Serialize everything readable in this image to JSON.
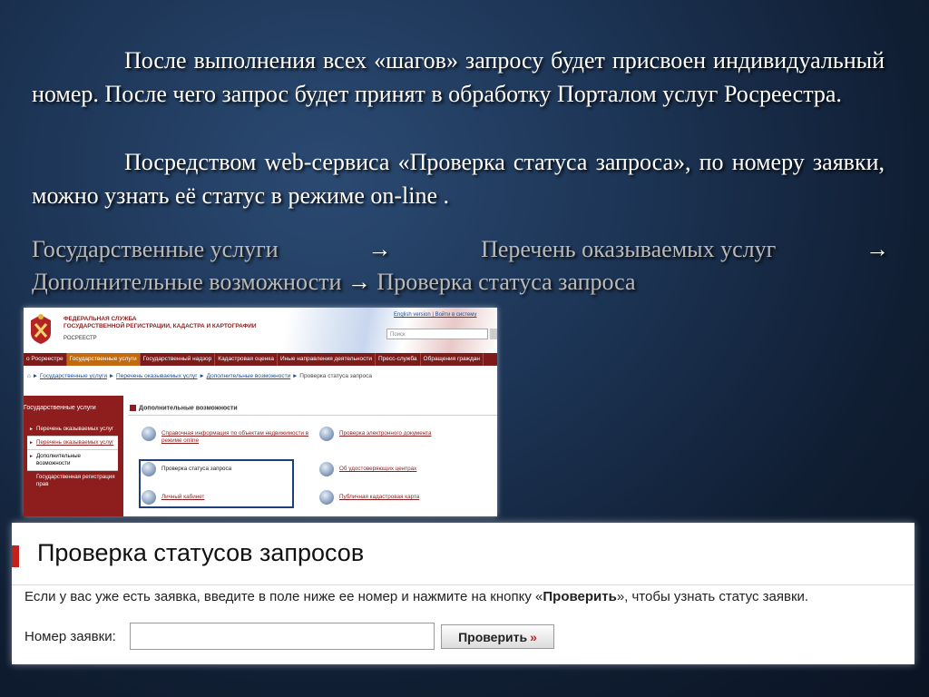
{
  "slide": {
    "p1": "После выполнения всех «шагов» запросу будет  присвоен индивидуальный номер.  После чего запрос будет принят в обработку Порталом услуг Росреестра.",
    "p2": "Посредством web-сервиса «Проверка статуса запроса», по номеру заявки, можно узнать её статус в режиме on-line .",
    "nav_path": {
      "item1": "Государственные услуги",
      "item2": "Перечень оказываемых услуг",
      "item3": "Дополнительные возможности",
      "item4": "Проверка статуса запроса",
      "arrow": "→"
    }
  },
  "portal": {
    "org_line1": "ФЕДЕРАЛЬНАЯ СЛУЖБА",
    "org_line2": "ГОСУДАРСТВЕННОЙ РЕГИСТРАЦИИ, КАДАСТРА И КАРТОГРАФИИ",
    "org_short": "РОСРЕЕСТР",
    "toplinks": "English version | Войти в систему",
    "search_placeholder": "Поиск",
    "menu": [
      "о Росреестре",
      "Государственные услуги",
      "Государственный надзор",
      "Кадастровая оценка",
      "Иные направления деятельности",
      "Пресс-служба",
      "Обращения граждан"
    ],
    "breadcrumbs": {
      "home": "⌂",
      "sep": "►",
      "c1": "Государственные услуги",
      "c2": "Перечень оказываемых услуг",
      "c3": "Дополнительные возможности",
      "c4": "Проверка статуса запроса"
    },
    "sidebar": {
      "title": "Государственные услуги",
      "items": [
        "Перечень оказываемых услуг",
        "Перечень оказываемых услуг",
        "Дополнительные возможности",
        "Государственная регистрация прав"
      ]
    },
    "section_title": "Дополнительные возможности",
    "services": {
      "s1": "Справочная информация по объектам недвижимости в режиме online",
      "s2": "Проверка электронного документа",
      "s3": "Проверка статуса запроса",
      "s4": "Об удостоверяющих центрах",
      "s5": "Личный кабинет",
      "s6": "Публичная кадастровая карта"
    }
  },
  "status_check": {
    "title": "Проверка статусов запросов",
    "desc_before": "Если у вас уже есть заявка, введите в поле ниже ее номер и нажмите на кнопку «",
    "desc_bold": "Проверить",
    "desc_after": "», чтобы узнать статус заявки.",
    "field_label": "Номер заявки:",
    "field_value": "",
    "button_label": "Проверить",
    "button_chevron": "»"
  },
  "colors": {
    "accent_red": "#c2211c",
    "portal_maroon": "#8e1d1d",
    "menu_active": "#c26a10",
    "link_blue": "#1a4f9c"
  }
}
